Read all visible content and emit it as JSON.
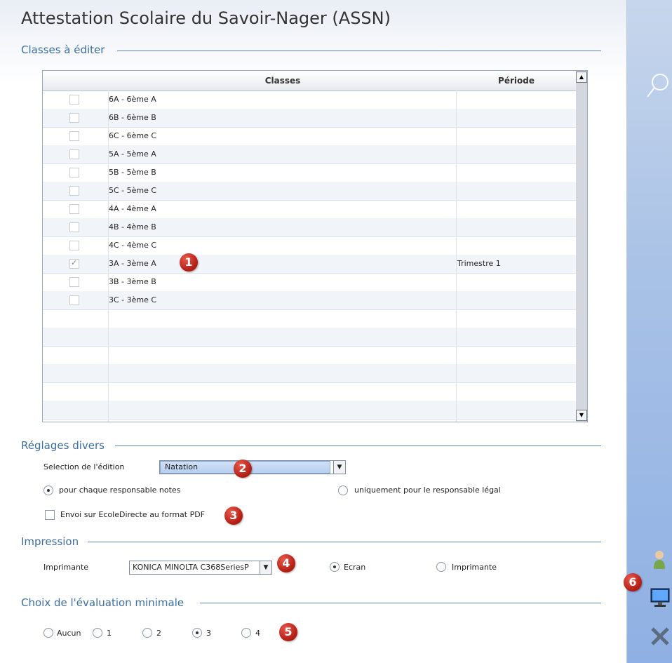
{
  "title": "Attestation Scolaire du Savoir-Nager (ASSN)",
  "sections": {
    "classes": "Classes à éditer",
    "reglages": "Réglages divers",
    "impression": "Impression",
    "evaluation": "Choix de l'évaluation minimale"
  },
  "table": {
    "col_classes": "Classes",
    "col_periode": "Période",
    "rows": [
      {
        "label": "6A - 6ème A",
        "checked": false,
        "periode": ""
      },
      {
        "label": "6B - 6ème B",
        "checked": false,
        "periode": ""
      },
      {
        "label": "6C - 6ème C",
        "checked": false,
        "periode": ""
      },
      {
        "label": "5A - 5ème A",
        "checked": false,
        "periode": ""
      },
      {
        "label": "5B - 5ème B",
        "checked": false,
        "periode": ""
      },
      {
        "label": "5C - 5ème C",
        "checked": false,
        "periode": ""
      },
      {
        "label": "4A - 4ème A",
        "checked": false,
        "periode": ""
      },
      {
        "label": "4B - 4ème B",
        "checked": false,
        "periode": ""
      },
      {
        "label": "4C - 4ème C",
        "checked": false,
        "periode": ""
      },
      {
        "label": "3A - 3ème A",
        "checked": true,
        "periode": "Trimestre 1"
      },
      {
        "label": "3B - 3ème B",
        "checked": false,
        "periode": ""
      },
      {
        "label": "3C - 3ème C",
        "checked": false,
        "periode": ""
      }
    ]
  },
  "reglages": {
    "selection_label": "Selection de l'édition",
    "selection_value": "Natation",
    "radio_chaque": "pour chaque responsable notes",
    "radio_legal": "uniquement pour le responsable légal",
    "envoi_label": "Envoi sur EcoleDirecte au format PDF"
  },
  "impression": {
    "imprimante_label": "Imprimante",
    "imprimante_value": "KONICA MINOLTA C368SeriesP",
    "radio_ecran": "Ecran",
    "radio_imprimante": "Imprimante"
  },
  "evaluation": {
    "options": [
      "Aucun",
      "1",
      "2",
      "3",
      "4"
    ],
    "selected": "3"
  },
  "badges": [
    "1",
    "2",
    "3",
    "4",
    "5",
    "6"
  ],
  "icons": [
    "search-icon",
    "user-icon",
    "monitor-icon",
    "close-icon"
  ]
}
